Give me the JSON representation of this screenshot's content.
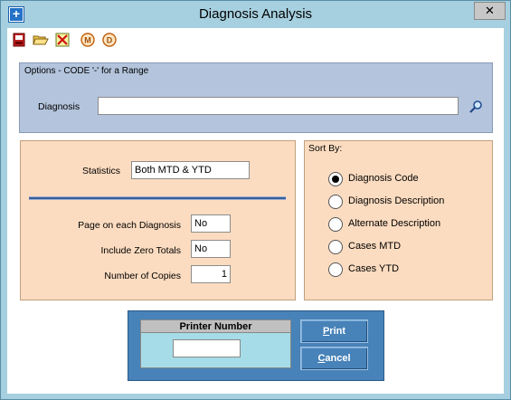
{
  "window": {
    "title": "Diagnosis Analysis",
    "close_label": "✕"
  },
  "toolbar": {
    "buttons": [
      "save-icon",
      "open-folder-icon",
      "delete-icon",
      "mtd-icon",
      "d-icon"
    ]
  },
  "options": {
    "caption": "Options - CODE '-' for a Range",
    "diagnosis_label": "Diagnosis",
    "diagnosis_value": ""
  },
  "stats": {
    "statistics_label": "Statistics",
    "statistics_value": "Both MTD & YTD",
    "page_label": "Page on each Diagnosis",
    "page_value": "No",
    "zero_label": "Include Zero Totals",
    "zero_value": "No",
    "copies_label": "Number of Copies",
    "copies_value": "1"
  },
  "sort": {
    "caption": "Sort By:",
    "options": [
      {
        "label": "Diagnosis Code",
        "selected": true
      },
      {
        "label": "Diagnosis Description",
        "selected": false
      },
      {
        "label": "Alternate Description",
        "selected": false
      },
      {
        "label": "Cases MTD",
        "selected": false
      },
      {
        "label": "Cases YTD",
        "selected": false
      }
    ]
  },
  "printer": {
    "header": "Printer Number",
    "value": "",
    "print_first": "P",
    "print_rest": "rint",
    "cancel_first": "C",
    "cancel_rest": "ancel"
  },
  "colors": {
    "window_frame": "#a6d0df",
    "options_panel": "#b3c4dc",
    "stats_panel": "#fcdcc0",
    "print_panel": "#4782b8"
  }
}
